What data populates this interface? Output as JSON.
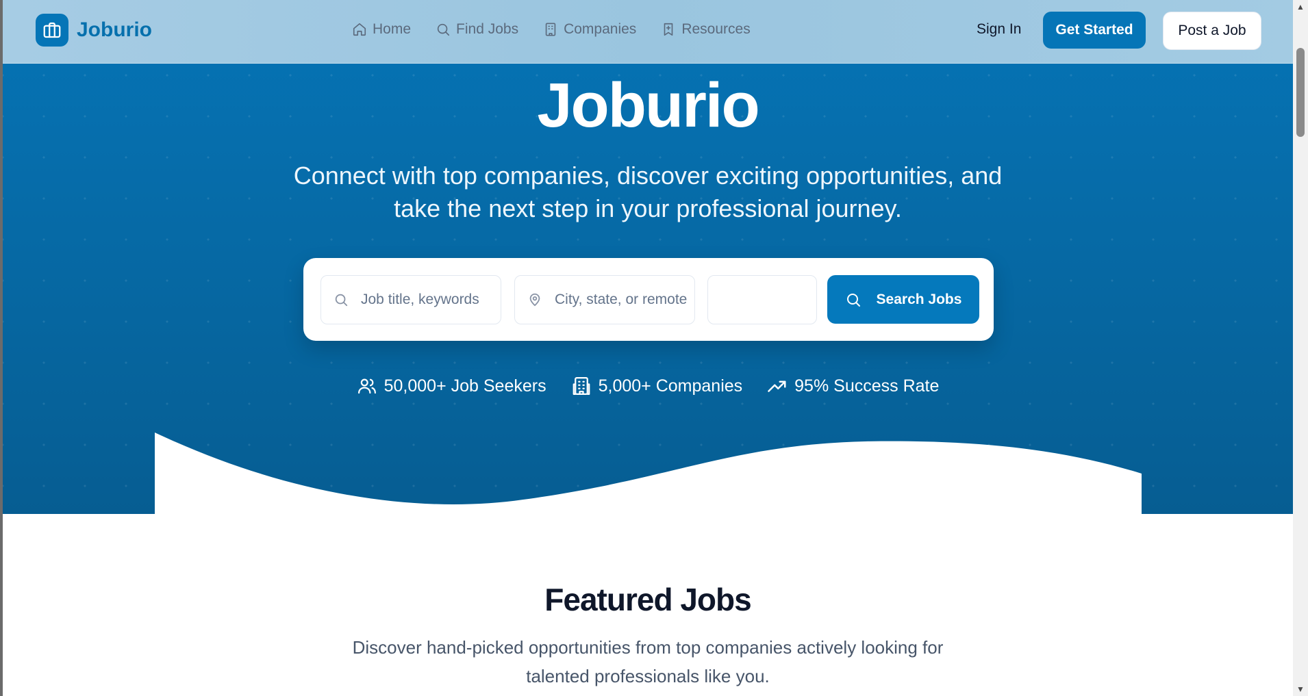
{
  "nav": {
    "brand": "Joburio",
    "links": [
      {
        "label": "Home",
        "icon": "home-icon"
      },
      {
        "label": "Find Jobs",
        "icon": "search-icon"
      },
      {
        "label": "Companies",
        "icon": "building-icon"
      },
      {
        "label": "Resources",
        "icon": "bookmark-icon"
      }
    ],
    "sign_in": "Sign In",
    "get_started": "Get Started",
    "post_job": "Post a Job"
  },
  "hero": {
    "title": "Joburio",
    "subtitle_line1": "Connect with top companies, discover exciting opportunities, and",
    "subtitle_line2": "take the next step in your professional journey."
  },
  "search": {
    "job_placeholder": "Job title, keywords",
    "location_placeholder": "City, state, or remote",
    "type_value": "",
    "button_label": "Search Jobs"
  },
  "stats": [
    {
      "label": "50,000+ Job Seekers",
      "icon": "users-icon"
    },
    {
      "label": "5,000+ Companies",
      "icon": "building-icon"
    },
    {
      "label": "95% Success Rate",
      "icon": "trending-up-icon"
    }
  ],
  "featured": {
    "title": "Featured Jobs",
    "subtitle_line1": "Discover hand-picked opportunities from top companies actively looking for",
    "subtitle_line2": "talented professionals like you."
  },
  "colors": {
    "brand": "#0575b7",
    "hero_bg": "#066aa6",
    "text_dark": "#0f172a",
    "muted": "#475569"
  }
}
